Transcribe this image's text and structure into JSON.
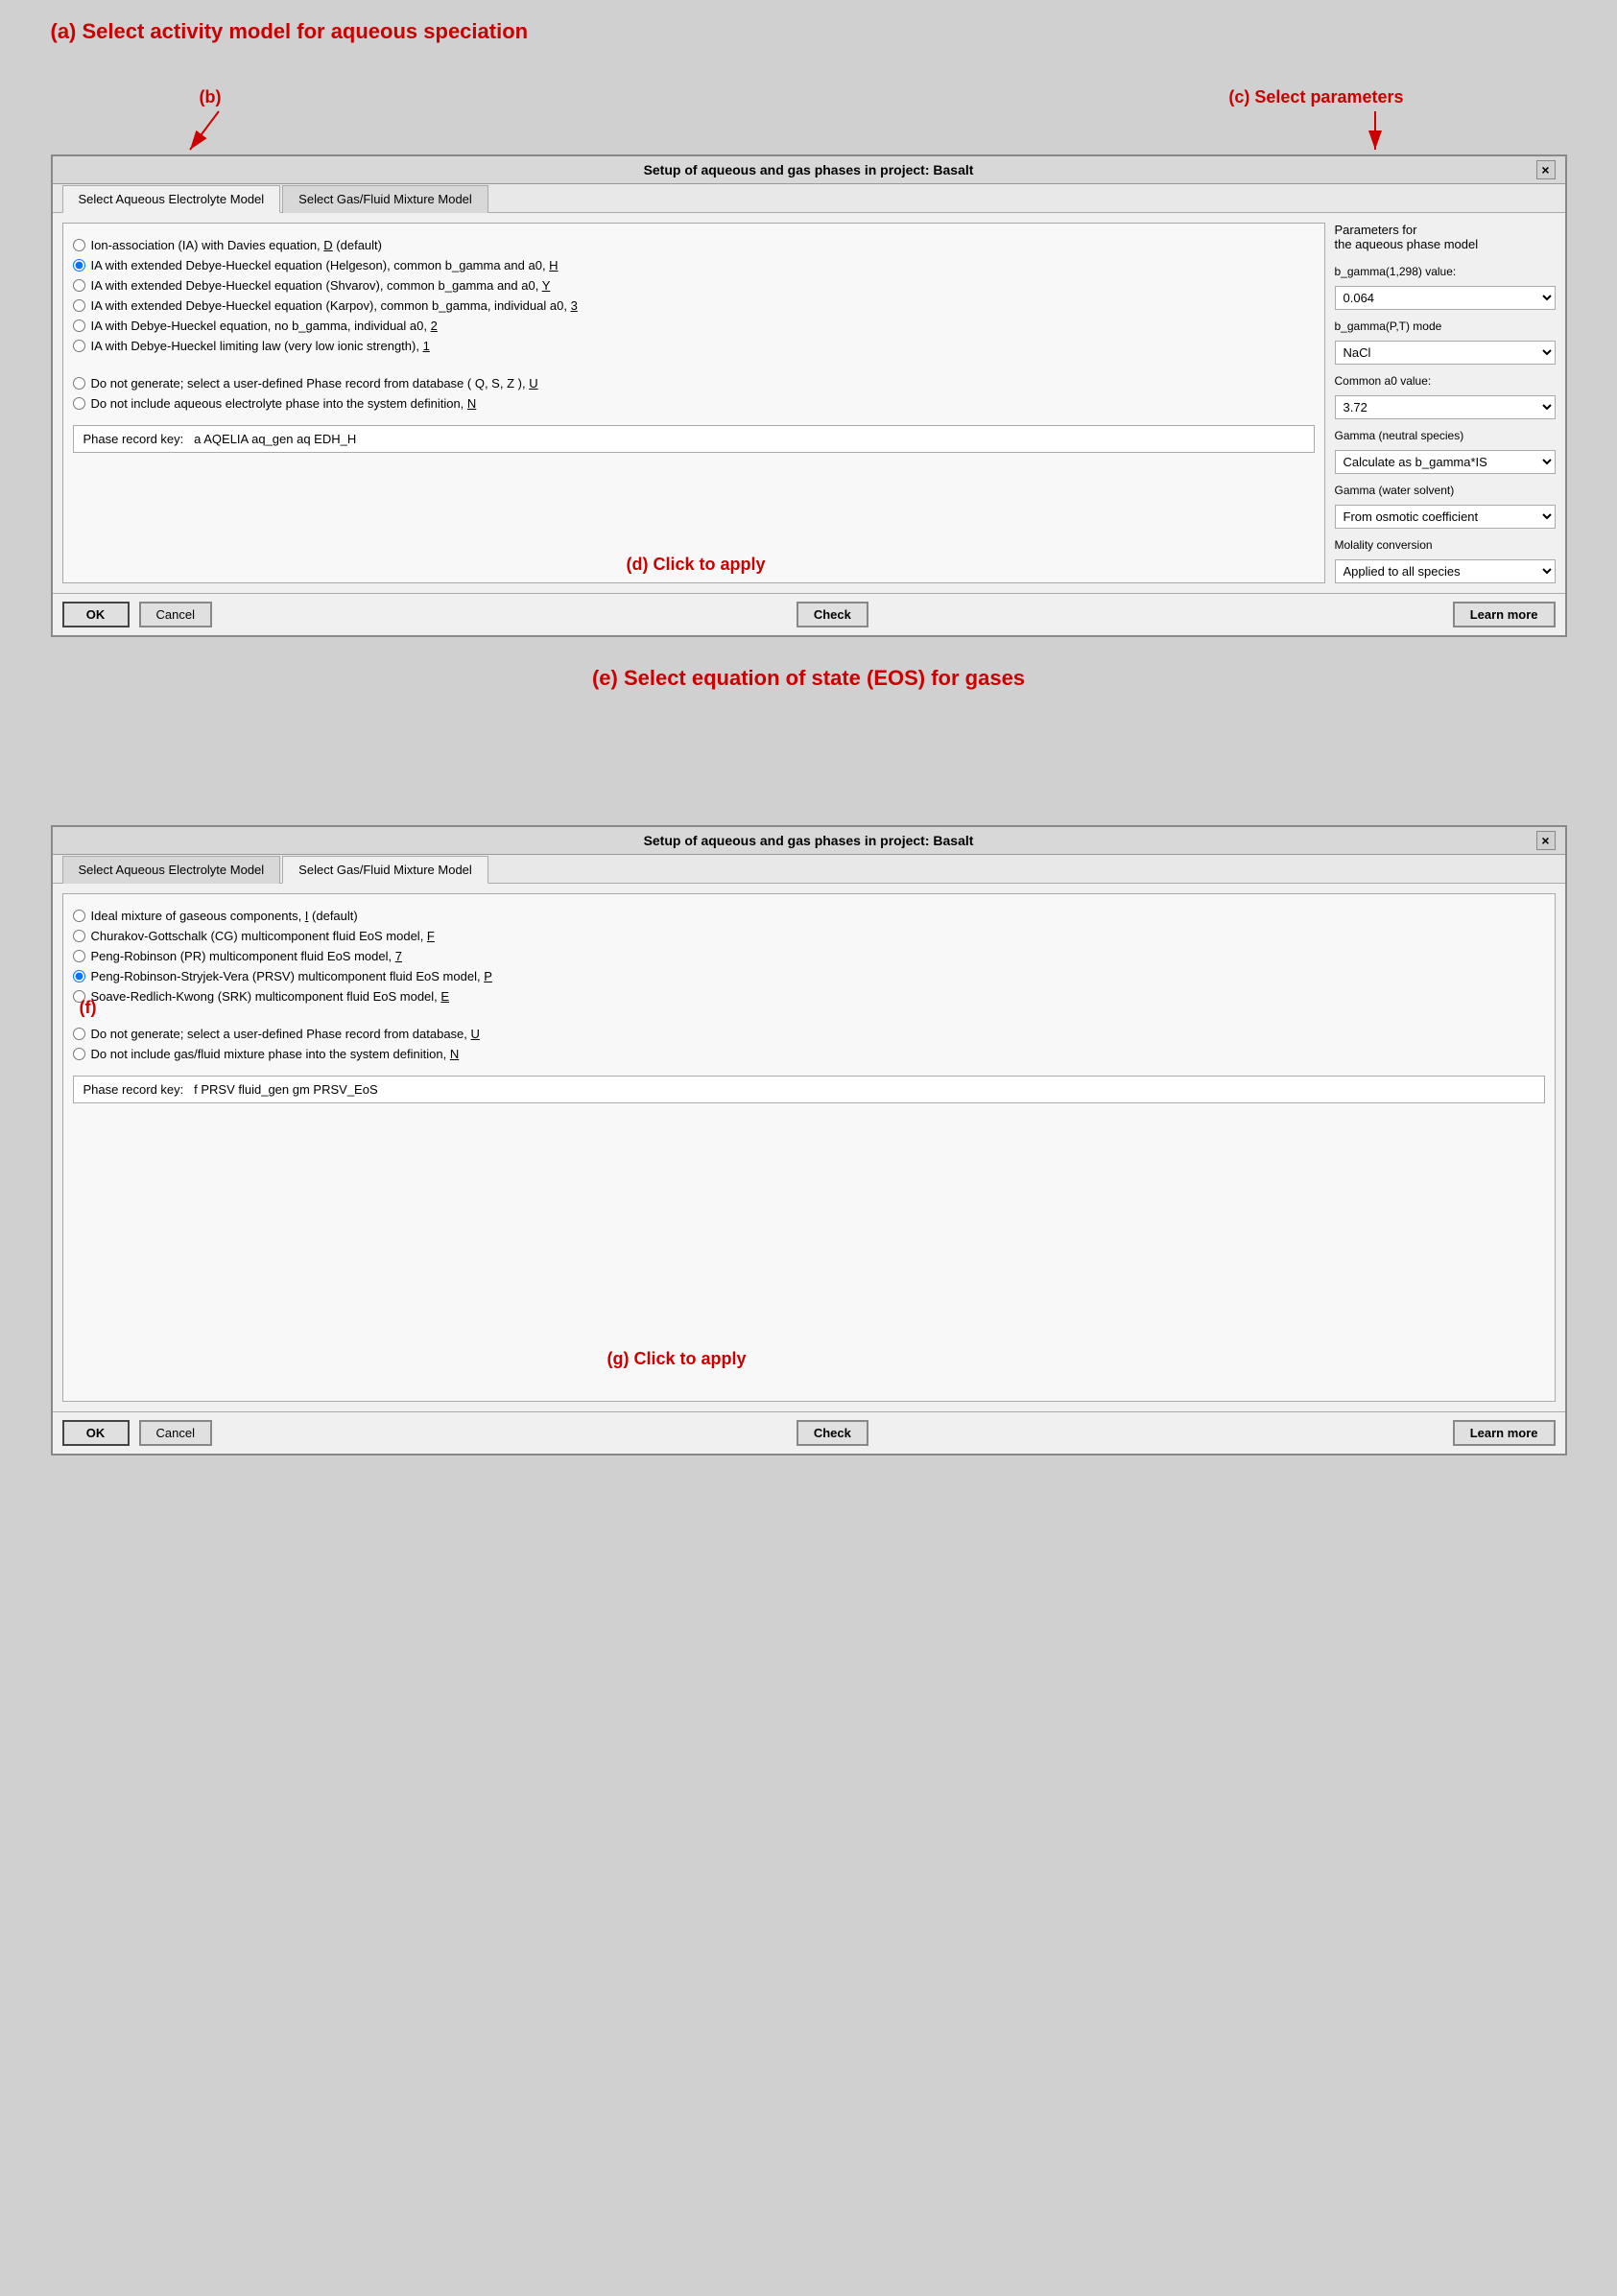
{
  "page": {
    "bg_color": "#d0d0d0"
  },
  "annotation_a": "(a) Select activity model for aqueous speciation",
  "annotation_b": "(b)",
  "annotation_c": "(c) Select parameters",
  "annotation_d": "(d) Click to apply",
  "annotation_e": "(e) Select equation of state (EOS) for gases",
  "annotation_f": "(f)",
  "annotation_g": "(g) Click to apply",
  "dialog1": {
    "title": "Setup of aqueous and gas phases in project:  Basalt",
    "close": "×",
    "tab1": "Select Aqueous Electrolyte Model",
    "tab2": "Select Gas/Fluid Mixture Model",
    "options": [
      {
        "id": "opt1",
        "label": "Ion-association (IA)  with Davies equation, ",
        "underline": "D",
        "suffix": " (default)",
        "checked": false
      },
      {
        "id": "opt2",
        "label": "IA with extended Debye-Hueckel equation (Helgeson), common b_gamma and a0, ",
        "underline": "H",
        "suffix": "",
        "checked": true
      },
      {
        "id": "opt3",
        "label": "IA with extended Debye-Hueckel equation (Shvarov), common b_gamma and a0, ",
        "underline": "Y",
        "suffix": "",
        "checked": false
      },
      {
        "id": "opt4",
        "label": "IA with extended Debye-Hueckel equation (Karpov), common b_gamma, individual a0, ",
        "underline": "3",
        "suffix": "",
        "checked": false
      },
      {
        "id": "opt5",
        "label": "IA with Debye-Hueckel equation, no b_gamma, individual a0, ",
        "underline": "2",
        "suffix": "",
        "checked": false
      },
      {
        "id": "opt6",
        "label": "IA with Debye-Hueckel limiting law (very low ionic strength), ",
        "underline": "1",
        "suffix": "",
        "checked": false
      },
      {
        "id": "opt7",
        "label": "Do not generate; select a user-defined Phase record from database ( Q, S, Z ), ",
        "underline": "U",
        "suffix": "",
        "checked": false
      },
      {
        "id": "opt8",
        "label": "Do not include aqueous electrolyte phase into the system definition, ",
        "underline": "N",
        "suffix": "",
        "checked": false
      }
    ],
    "phase_record_label": "Phase record key:",
    "phase_record_value": "a   AQELIA  aq_gen       aq  EDH_H",
    "params_title": "Parameters for\nthe aqueous phase model",
    "param_b_gamma_label": "b_gamma(1,298) value:",
    "param_b_gamma_value": "0.064",
    "param_b_gamma_mode_label": "b_gamma(P,T) mode",
    "param_b_gamma_mode_value": "NaCl",
    "param_a0_label": "Common a0 value:",
    "param_a0_value": "3.72",
    "param_gamma_neutral_label": "Gamma (neutral species)",
    "param_gamma_neutral_value": "Calculate as b_gamma*IS",
    "param_gamma_water_label": "Gamma (water solvent)",
    "param_gamma_water_value": "From osmotic coefficient",
    "param_molality_label": "Molality conversion",
    "param_molality_value": "Applied to all species",
    "btn_ok": "OK",
    "btn_cancel": "Cancel",
    "btn_check": "Check",
    "btn_learn": "Learn more"
  },
  "dialog2": {
    "title": "Setup of aqueous and gas phases in project:  Basalt",
    "close": "×",
    "tab1": "Select Aqueous Electrolyte Model",
    "tab2": "Select Gas/Fluid Mixture Model",
    "options": [
      {
        "id": "g_opt1",
        "label": "Ideal mixture of gaseous components, ",
        "underline": "I",
        "suffix": " (default)",
        "checked": false
      },
      {
        "id": "g_opt2",
        "label": "Churakov-Gottschalk (CG) multicomponent fluid EoS model, ",
        "underline": "F",
        "suffix": "",
        "checked": false
      },
      {
        "id": "g_opt3",
        "label": "Peng-Robinson (PR) multicomponent fluid EoS model, ",
        "underline": "7",
        "suffix": "",
        "checked": false
      },
      {
        "id": "g_opt4",
        "label": "Peng-Robinson-Stryjek-Vera (PRSV) multicomponent fluid EoS model, ",
        "underline": "P",
        "suffix": "",
        "checked": true
      },
      {
        "id": "g_opt5",
        "label": "Soave-Redlich-Kwong (SRK) multicomponent fluid EoS model, ",
        "underline": "E",
        "suffix": "",
        "checked": false
      },
      {
        "id": "g_opt6",
        "label": "Do not generate; select a user-defined Phase record from database, ",
        "underline": "U",
        "suffix": "",
        "checked": false
      },
      {
        "id": "g_opt7",
        "label": "Do not include gas/fluid mixture phase into the system definition, ",
        "underline": "N",
        "suffix": "",
        "checked": false
      }
    ],
    "phase_record_label": "Phase record key:",
    "phase_record_value": "f   PRSV   fluid_gen       gm  PRSV_EoS",
    "btn_ok": "OK",
    "btn_cancel": "Cancel",
    "btn_check": "Check",
    "btn_learn": "Learn more"
  }
}
